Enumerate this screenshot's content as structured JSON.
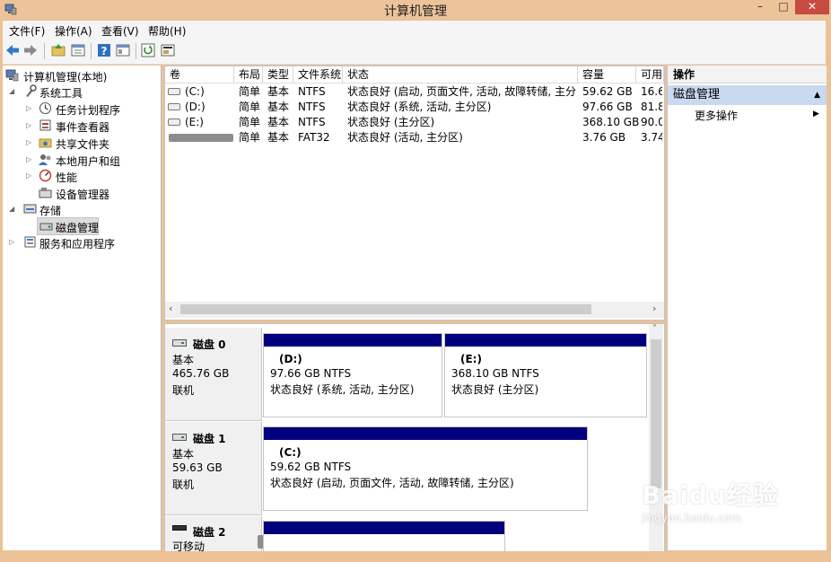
{
  "window": {
    "title": "计算机管理",
    "buttons": {
      "minimize": "–",
      "maximize": "□",
      "close": "✕"
    }
  },
  "menu": [
    "文件(F)",
    "操作(A)",
    "查看(V)",
    "帮助(H)"
  ],
  "toolbar": [
    "back-icon",
    "forward-icon",
    "up-folder-icon",
    "properties-icon",
    "help-icon",
    "view-icon",
    "refresh-icon",
    "export-icon"
  ],
  "tree": [
    {
      "label": "计算机管理(本地)",
      "level": 0,
      "expander": "",
      "icon": "computer-icon"
    },
    {
      "label": "系统工具",
      "level": 1,
      "expander": "◢",
      "icon": "tools-icon"
    },
    {
      "label": "任务计划程序",
      "level": 2,
      "expander": "▷",
      "icon": "clock-icon"
    },
    {
      "label": "事件查看器",
      "level": 2,
      "expander": "▷",
      "icon": "event-icon"
    },
    {
      "label": "共享文件夹",
      "level": 2,
      "expander": "▷",
      "icon": "share-icon"
    },
    {
      "label": "本地用户和组",
      "level": 2,
      "expander": "▷",
      "icon": "users-icon"
    },
    {
      "label": "性能",
      "level": 2,
      "expander": "▷",
      "icon": "performance-icon"
    },
    {
      "label": "设备管理器",
      "level": 2,
      "expander": "",
      "icon": "device-icon"
    },
    {
      "label": "存储",
      "level": 1,
      "expander": "◢",
      "icon": "storage-icon"
    },
    {
      "label": "磁盘管理",
      "level": 2,
      "expander": "",
      "icon": "disk-icon",
      "selected": true
    },
    {
      "label": "服务和应用程序",
      "level": 1,
      "expander": "▷",
      "icon": "services-icon"
    }
  ],
  "volumes": {
    "headers": [
      "卷",
      "布局",
      "类型",
      "文件系统",
      "状态",
      "容量",
      "可用"
    ],
    "rows": [
      [
        "(C:)",
        "简单",
        "基本",
        "NTFS",
        "状态良好 (启动, 页面文件, 活动, 故障转储, 主分区)",
        "59.62 GB",
        "16.6"
      ],
      [
        "(D:)",
        "简单",
        "基本",
        "NTFS",
        "状态良好 (系统, 活动, 主分区)",
        "97.66 GB",
        "81.8"
      ],
      [
        "(E:)",
        "简单",
        "基本",
        "NTFS",
        "状态良好 (主分区)",
        "368.10 GB",
        "90.0"
      ],
      [
        "",
        "简单",
        "基本",
        "FAT32",
        "状态良好 (活动, 主分区)",
        "3.76 GB",
        "3.74"
      ]
    ]
  },
  "disks": [
    {
      "name": "磁盘 0",
      "type": "基本",
      "size": "465.76 GB",
      "state": "联机",
      "partitions": [
        {
          "title": "(D:)",
          "size": "97.66 GB NTFS",
          "status": "状态良好 (系统, 活动, 主分区)"
        },
        {
          "title": "(E:)",
          "size": "368.10 GB NTFS",
          "status": "状态良好 (主分区)"
        }
      ]
    },
    {
      "name": "磁盘 1",
      "type": "基本",
      "size": "59.63 GB",
      "state": "联机",
      "partitions": [
        {
          "title": "(C:)",
          "size": "59.62 GB NTFS",
          "status": "状态良好 (启动, 页面文件, 活动, 故障转储, 主分区)"
        }
      ]
    },
    {
      "name": "磁盘 2",
      "type": "可移动",
      "size": "",
      "state": "",
      "partitions": []
    }
  ],
  "actions": {
    "header": "操作",
    "section": "磁盘管理",
    "more": "更多操作"
  },
  "watermark": {
    "brand": "Baidu经验",
    "url": "jingyan.baidu.com"
  },
  "colors": {
    "titlebar": "#edc39a",
    "partition_bar": "#00007e",
    "action_section": "#c9d9ef"
  }
}
